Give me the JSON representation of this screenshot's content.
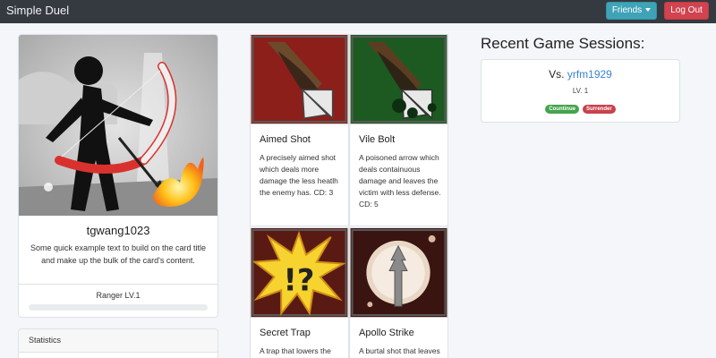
{
  "navbar": {
    "brand": "Simple Duel",
    "friends_label": "Friends",
    "logout_label": "Log Out",
    "colors": {
      "bar": "#343a40",
      "friends": "#3fa3b8",
      "logout": "#d0434f"
    }
  },
  "profile": {
    "username": "tgwang1023",
    "text": "Some quick example text to build on the card title and make up the bulk of the card's content.",
    "rank": "Ranger LV.1",
    "progress": 0
  },
  "stats": {
    "header": "Statistics"
  },
  "skills": [
    {
      "title": "Aimed Shot",
      "description": "A precisely aimed shot which deals more damage the less heatlh the enemy has. CD: 3",
      "icon": "arrow-icon"
    },
    {
      "title": "Vile Bolt",
      "description": "A poisoned arrow which deals containuous damage and leaves the victim with less defense. CD: 5",
      "icon": "poison-arrow-icon"
    },
    {
      "title": "Secret Trap",
      "description": "A trap that lowers the speed of",
      "icon": "trap-icon"
    },
    {
      "title": "Apollo Strike",
      "description": "A burtal shot that leaves the",
      "icon": "apollo-strike-icon"
    }
  ],
  "recent": {
    "title": "Recent Game Sessions:",
    "sessions": [
      {
        "vs_prefix": "Vs.",
        "opponent": "yrfm1929",
        "level": "LV. 1",
        "continue_label": "Countinue",
        "surrender_label": "Surrender"
      }
    ]
  }
}
